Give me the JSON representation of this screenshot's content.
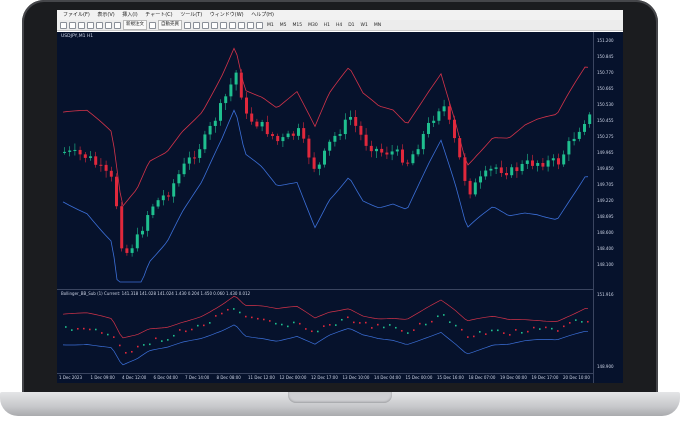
{
  "menu": [
    "ファイル(F)",
    "表示(V)",
    "挿入(I)",
    "チャート(C)",
    "ツール(T)",
    "ウィンドウ(W)",
    "ヘルプ(H)"
  ],
  "toolbar": {
    "new_order": "新規注文",
    "auto_trade": "自動売買",
    "timeframes": [
      "M1",
      "M5",
      "M15",
      "M30",
      "H1",
      "H4",
      "D1",
      "W1",
      "MN"
    ]
  },
  "chart": {
    "caption": "USDJPY,M1 H1",
    "indicator_caption": "Bollinger_BB_Sub (1) Current: 141.318  141.028  141.024  1.430  0.204  1.450  0.060  1.430  0.012",
    "price_labels": [
      "151.200",
      "150.845",
      "150.770",
      "150.665",
      "150.530",
      "150.455",
      "150.275",
      "149.965",
      "149.850",
      "149.705",
      "149.220",
      "148.695",
      "148.600",
      "148.400",
      "148.100"
    ],
    "sub_labels": [
      "151.916",
      "148.900"
    ],
    "time_labels": [
      "1 Dec 2023",
      "1 Dec 09:00",
      "4 Dec 12:00",
      "6 Dec 04:00",
      "7 Dec 14:00",
      "8 Dec 08:00",
      "11 Dec 12:00",
      "12 Dec 00:00",
      "12 Dec 17:00",
      "13 Dec 10:00",
      "14 Dec 04:00",
      "15 Dec 00:00",
      "15 Dec 16:00",
      "18 Dec 07:00",
      "19 Dec 00:00",
      "19 Dec 17:00",
      "20 Dec 10:00"
    ]
  },
  "colors": {
    "background": "#06122c",
    "up": "#1fbf8f",
    "down": "#e0283c",
    "upper_band": "#d4334a",
    "lower_band": "#3b6fd8"
  }
}
